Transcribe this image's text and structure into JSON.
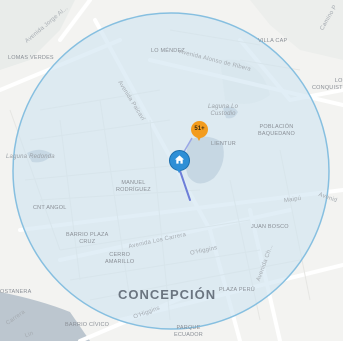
{
  "map": {
    "labels": {
      "lomas_verdes": "LOMAS VERDES",
      "lo_mendez": "LO MÉNDEZ",
      "villa_cap": "VILLA CAP",
      "lo_conquista": "LO\nCONQUIST",
      "laguna_lo_custodio": "Laguna Lo\nCustodio",
      "lientur": "LIENTUR",
      "poblacion_baquedano": "POBLACIÓN\nBAQUEDANO",
      "laguna_redonda": "Laguna Redonda",
      "manuel_rodriguez": "MANUEL\nRODRÍGUEZ",
      "cnt_angol": "CNT ANGOL",
      "barrio_plaza_cruz": "BARRIO PLAZA\nCRUZ",
      "juan_bosco": "JUAN BOSCO",
      "cerro_amarillo": "CERRO\nAMARILLO",
      "concepcion": "CONCEPCIÓN",
      "plaza_peru": "PLAZA PERÚ",
      "costanera": "OSTANERA",
      "barrio_civico": "BARRIO CÍVICO",
      "parque_ecuador": "PARQUE\nECUADOR"
    },
    "streets": {
      "av_jorge_alessandri": "Avenida Jorge Al...",
      "av_alonso_ribera": "Avenida Alonso de Ribera",
      "av_paicavi": "Avenida Paicaví",
      "av_los_carrera": "Avenida Los Carrera",
      "ohiggins": "O'Higgins",
      "ohiggins_2": "O'Higgins",
      "maipu": "Maipú",
      "avenida_right": "Avenid",
      "av_chacabuco": "Avenida Ch...",
      "carrera_top": "Carrera",
      "camino_right": "Camino P",
      "lin": "Lin"
    },
    "price_marker": "51+",
    "colors": {
      "radius_fill": "#cfe3f1",
      "radius_stroke": "#86bfe0",
      "water": "#b7c2cb",
      "price_pin": "#f39c1e",
      "home_pin": "#2e8fd6"
    },
    "icons": {
      "home_marker": "home-icon",
      "price_marker": "map-pin-icon"
    }
  }
}
